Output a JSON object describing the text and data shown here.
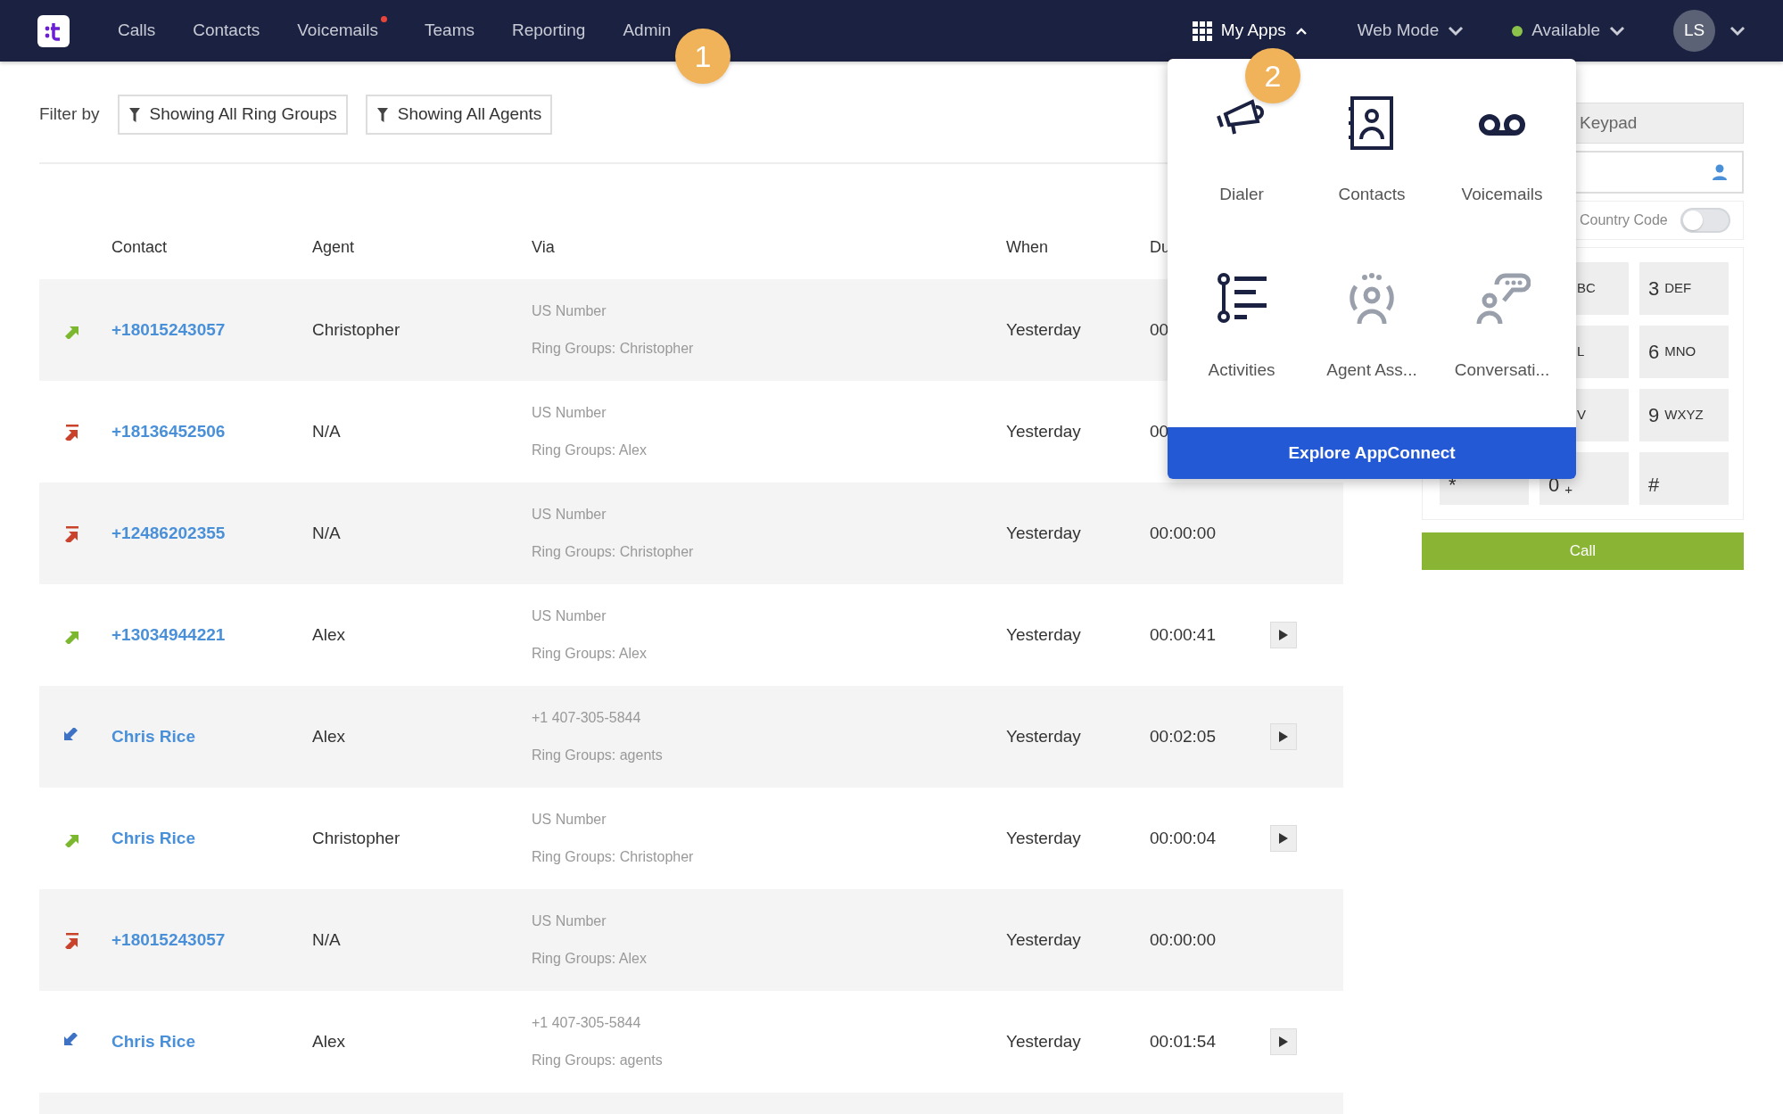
{
  "nav": {
    "items": [
      {
        "label": "Calls",
        "notification": false
      },
      {
        "label": "Contacts",
        "notification": false
      },
      {
        "label": "Voicemails",
        "notification": true
      },
      {
        "label": "Teams",
        "notification": false
      },
      {
        "label": "Reporting",
        "notification": false
      },
      {
        "label": "Admin",
        "notification": false
      }
    ],
    "apps": {
      "label": "My Apps",
      "expanded": true
    },
    "mode": "Web Mode",
    "status": {
      "label": "Available",
      "color": "#8bc34a"
    },
    "avatar": "LS"
  },
  "callouts": [
    "1",
    "2"
  ],
  "filter": {
    "label": "Filter by",
    "buttons": [
      "Showing All Ring Groups",
      "Showing All Agents"
    ]
  },
  "table": {
    "columns": [
      "Contact",
      "Agent",
      "Via",
      "When",
      "Du"
    ],
    "rows": [
      {
        "kind": "outbound",
        "contact": "+18015243057",
        "agent": "Christopher",
        "via": "US Number",
        "group": "Ring Groups: Christopher",
        "when": "Yesterday",
        "duration": "00",
        "recording": false
      },
      {
        "kind": "missed",
        "contact": "+18136452506",
        "agent": "N/A",
        "via": "US Number",
        "group": "Ring Groups: Alex",
        "when": "Yesterday",
        "duration": "00",
        "recording": false
      },
      {
        "kind": "missed",
        "contact": "+12486202355",
        "agent": "N/A",
        "via": "US Number",
        "group": "Ring Groups: Christopher",
        "when": "Yesterday",
        "duration": "00:00:00",
        "recording": false
      },
      {
        "kind": "outbound",
        "contact": "+13034944221",
        "agent": "Alex",
        "via": "US Number",
        "group": "Ring Groups: Alex",
        "when": "Yesterday",
        "duration": "00:00:41",
        "recording": true
      },
      {
        "kind": "inbound",
        "contact": "Chris Rice",
        "agent": "Alex",
        "via": "+1 407-305-5844",
        "group": "Ring Groups: agents",
        "when": "Yesterday",
        "duration": "00:02:05",
        "recording": true
      },
      {
        "kind": "outbound",
        "contact": "Chris Rice",
        "agent": "Christopher",
        "via": "US Number",
        "group": "Ring Groups: Christopher",
        "when": "Yesterday",
        "duration": "00:00:04",
        "recording": true
      },
      {
        "kind": "missed",
        "contact": "+18015243057",
        "agent": "N/A",
        "via": "US Number",
        "group": "Ring Groups: Alex",
        "when": "Yesterday",
        "duration": "00:00:00",
        "recording": false
      },
      {
        "kind": "inbound",
        "contact": "Chris Rice",
        "agent": "Alex",
        "via": "+1 407-305-5844",
        "group": "Ring Groups: agents",
        "when": "Yesterday",
        "duration": "00:01:54",
        "recording": true
      }
    ]
  },
  "dialer": {
    "tab": "Keypad",
    "country_code": {
      "label": "Country Code",
      "on": false
    },
    "keys": [
      {
        "letters": "BC"
      },
      {
        "digit": "3",
        "letters": "DEF"
      },
      {
        "letters": "L"
      },
      {
        "digit": "6",
        "letters": "MNO"
      },
      {
        "letters": "V"
      },
      {
        "digit": "9",
        "letters": "WXYZ"
      },
      {
        "digit": "*"
      },
      {
        "digit": "0",
        "letters": "+"
      },
      {
        "digit": "#"
      }
    ],
    "call": "Call"
  },
  "apps_menu": {
    "apps": [
      {
        "kind": "dialer",
        "label": "Dialer"
      },
      {
        "kind": "contacts",
        "label": "Contacts"
      },
      {
        "kind": "voicemail",
        "label": "Voicemails"
      },
      {
        "kind": "activities",
        "label": "Activities"
      },
      {
        "kind": "agent",
        "label": "Agent Ass..."
      },
      {
        "kind": "conversation",
        "label": "Conversati..."
      }
    ],
    "footer": "Explore AppConnect"
  }
}
